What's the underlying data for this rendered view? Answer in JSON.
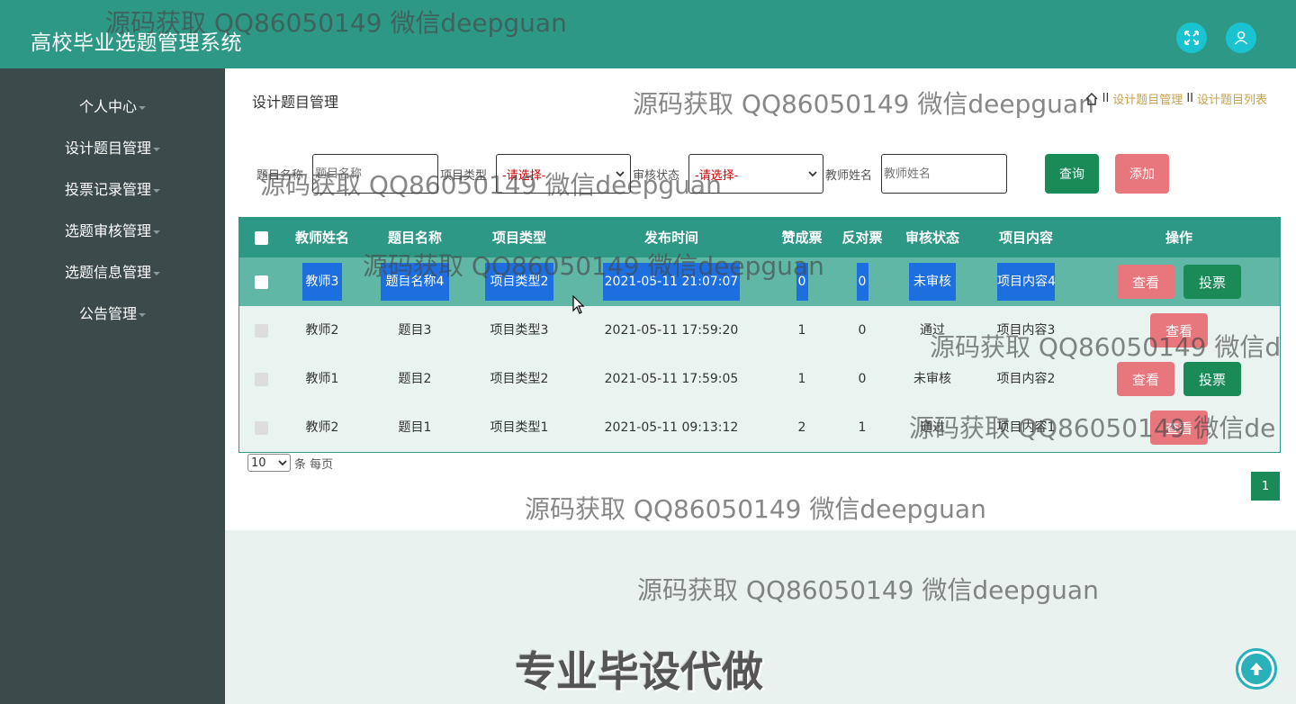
{
  "header": {
    "title": "高校毕业选题管理系统",
    "fullscreen_icon": "expand-icon",
    "user_icon": "user-icon"
  },
  "sidebar": {
    "items": [
      {
        "label": "个人中心"
      },
      {
        "label": "设计题目管理"
      },
      {
        "label": "投票记录管理"
      },
      {
        "label": "选题审核管理"
      },
      {
        "label": "选题信息管理"
      },
      {
        "label": "公告管理"
      }
    ]
  },
  "main": {
    "page_title": "设计题目管理",
    "breadcrumb": {
      "sep1": "II",
      "item1": "设计题目管理",
      "sep2": "II",
      "item2": "设计题目列表"
    }
  },
  "search": {
    "title_label": "题目名称",
    "title_placeholder": "题目名称",
    "type_label": "项目类型",
    "type_value": "-请选择-",
    "status_label": "审核状态",
    "status_value": "-请选择-",
    "teacher_label": "教师姓名",
    "teacher_placeholder": "教师姓名",
    "query_label": "查询",
    "add_label": "添加"
  },
  "table": {
    "headers": [
      "教师姓名",
      "题目名称",
      "项目类型",
      "发布时间",
      "赞成票",
      "反对票",
      "审核状态",
      "项目内容",
      "操作"
    ],
    "rows": [
      {
        "teacher": "教师3",
        "title": "题目名称4",
        "type": "项目类型2",
        "time": "2021-05-11 21:07:07",
        "yes": "0",
        "no": "0",
        "status": "未审核",
        "content": "项目内容4",
        "view": "查看",
        "vote": "投票"
      },
      {
        "teacher": "教师2",
        "title": "题目3",
        "type": "项目类型3",
        "time": "2021-05-11 17:59:20",
        "yes": "1",
        "no": "0",
        "status": "通过",
        "content": "项目内容3",
        "view": "查看"
      },
      {
        "teacher": "教师1",
        "title": "题目2",
        "type": "项目类型2",
        "time": "2021-05-11 17:59:05",
        "yes": "1",
        "no": "0",
        "status": "未审核",
        "content": "项目内容2",
        "view": "查看",
        "vote": "投票"
      },
      {
        "teacher": "教师2",
        "title": "题目1",
        "type": "项目类型1",
        "time": "2021-05-11 09:13:12",
        "yes": "2",
        "no": "1",
        "status": "通过",
        "content": "项目内容1",
        "view": "查看"
      }
    ]
  },
  "pager": {
    "page_size": "10",
    "per_page_label": "条 每页",
    "current_page": "1"
  },
  "watermarks": {
    "text": "源码获取 QQ86050149 微信deepguan",
    "text_cut1": "源码获取 QQ86050149 微信d",
    "text_cut2": "源码获取 QQ86050149 微信de",
    "big": "专业毕设代做"
  },
  "colors": {
    "header": "#2e9887",
    "sidebar": "#3b4a4a",
    "accent_green": "#1a8a57",
    "accent_pink": "#e8767d",
    "highlight": "#1d6fe0"
  }
}
